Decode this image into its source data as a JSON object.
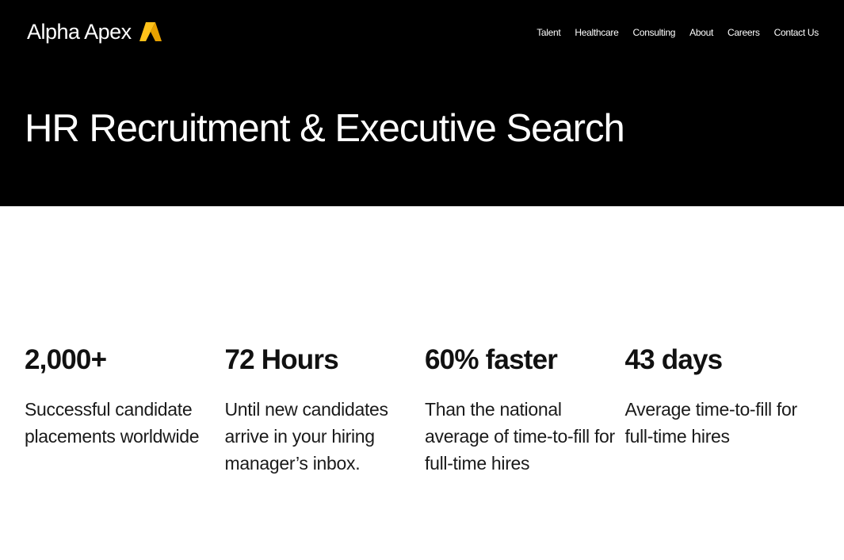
{
  "brand": {
    "name": "Alpha Apex",
    "logo_colors": {
      "light": "#FFC21A",
      "dark": "#E8A100"
    }
  },
  "nav": {
    "items": [
      {
        "label": "Talent"
      },
      {
        "label": "Healthcare"
      },
      {
        "label": "Consulting"
      },
      {
        "label": "About"
      },
      {
        "label": "Careers"
      },
      {
        "label": "Contact Us"
      }
    ]
  },
  "hero": {
    "title": "HR Recruitment & Executive Search",
    "background": "#000000"
  },
  "stats": [
    {
      "value": "2,000+",
      "description": "Successful candidate placements worldwide"
    },
    {
      "value": "72 Hours",
      "description": "Until new candidates arrive in your hiring manager’s inbox."
    },
    {
      "value": "60% faster",
      "description": "Than the national average of time-to-fill for full-time hires"
    },
    {
      "value": "43 days",
      "description": "Average time-to-fill for full-time hires"
    }
  ]
}
